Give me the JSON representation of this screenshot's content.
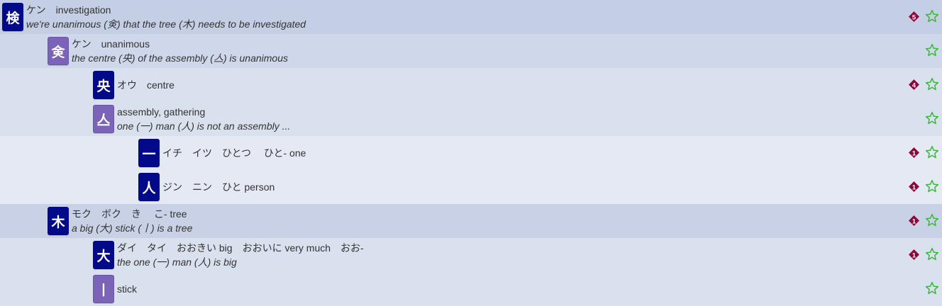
{
  "rows": [
    {
      "level": 0,
      "char": "検",
      "kind": "kanji",
      "reading": "ケン",
      "meaning": "investigation",
      "mnemonic": "we're unanimous (㑒) that the tree (木) needs to be investigated",
      "badge": "5"
    },
    {
      "level": 1,
      "char": "㑒",
      "kind": "part",
      "reading": "ケン",
      "meaning": "unanimous",
      "mnemonic": "the centre (央) of the assembly (亼) is unanimous",
      "badge": ""
    },
    {
      "level": 2,
      "char": "央",
      "kind": "kanji",
      "reading": "オウ",
      "meaning": "centre",
      "mnemonic": "",
      "badge": "4"
    },
    {
      "level": 2,
      "char": "亼",
      "kind": "part",
      "reading": "",
      "meaning": "assembly, gathering",
      "mnemonic": "one (一) man (人) is not an assembly ...",
      "badge": ""
    },
    {
      "level": 3,
      "char": "一",
      "kind": "kanji",
      "readings_text": "イチ　イツ　ひとつ　 ひと- one",
      "mnemonic": "",
      "badge": "1"
    },
    {
      "level": 3,
      "char": "人",
      "kind": "kanji",
      "readings_text": "ジン　ニン　ひと person",
      "mnemonic": "",
      "badge": "1"
    },
    {
      "level": 1,
      "char": "木",
      "kind": "kanji",
      "readings_text": "モク　ボク　き　 こ- tree",
      "mnemonic": "a big (大) stick (丨) is a tree",
      "badge": "1"
    },
    {
      "level": 2,
      "char": "大",
      "kind": "kanji",
      "readings_text": "ダイ　タイ　おおきい big　おおいに very much　おお-",
      "mnemonic": "the one (一) man (人) is big",
      "badge": "1"
    },
    {
      "level": 2,
      "char": "丨",
      "kind": "part",
      "readings_text": "stick",
      "mnemonic": "",
      "badge": ""
    }
  ],
  "colors": {
    "kanji_tile": "#020a8a",
    "part_tile": "#7b64b8",
    "badge": "#8a0a3c",
    "star": "#3cb83c"
  },
  "icons": {
    "badge": "diamond-number-badge-icon",
    "star": "star-outline-icon"
  }
}
